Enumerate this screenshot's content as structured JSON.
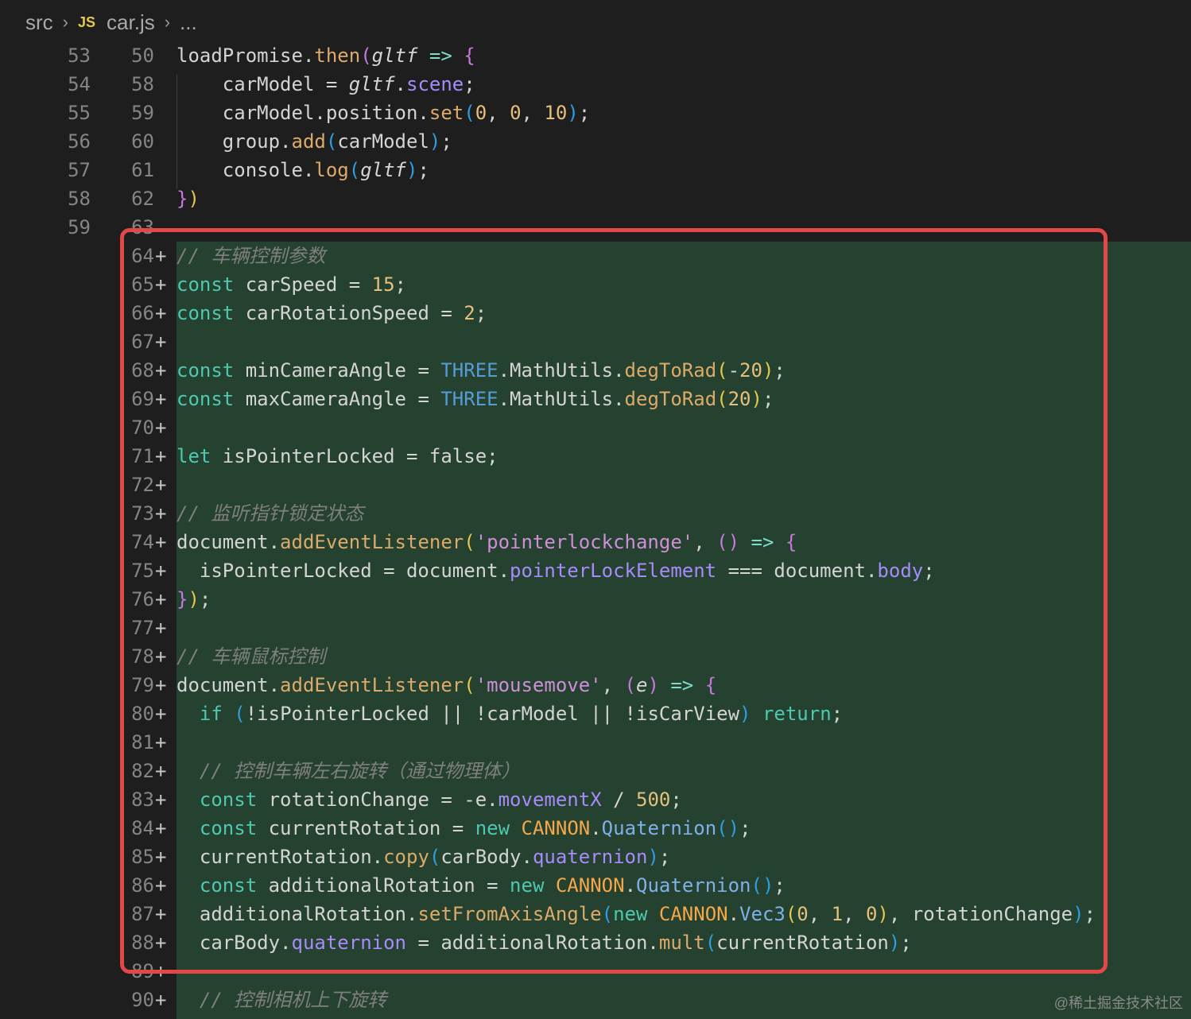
{
  "breadcrumb": {
    "folder": "src",
    "lang_badge": "JS",
    "file": "car.js",
    "ellipsis": "..."
  },
  "lines": [
    {
      "old": "53",
      "new": "50",
      "added": false,
      "tokens": [
        [
          "loadPromise.",
          ""
        ],
        [
          "then",
          "fn"
        ],
        [
          "(",
          "p2"
        ],
        [
          "gltf",
          "it"
        ],
        [
          " ",
          ""
        ],
        [
          "=>",
          "arrow"
        ],
        [
          " ",
          ""
        ],
        [
          "{",
          "p2"
        ]
      ]
    },
    {
      "old": "54",
      "new": "58",
      "added": false,
      "tokens": [
        [
          "    carModel = ",
          ""
        ],
        [
          "gltf",
          "it"
        ],
        [
          ".",
          ""
        ],
        [
          "scene",
          "prop"
        ],
        [
          ";",
          ""
        ]
      ]
    },
    {
      "old": "55",
      "new": "59",
      "added": false,
      "tokens": [
        [
          "    carModel.position.",
          ""
        ],
        [
          "set",
          "fn"
        ],
        [
          "(",
          "p3"
        ],
        [
          "0",
          "num"
        ],
        [
          ", ",
          ""
        ],
        [
          "0",
          "num"
        ],
        [
          ", ",
          ""
        ],
        [
          "10",
          "num"
        ],
        [
          ")",
          "p3"
        ],
        [
          ";",
          ""
        ]
      ]
    },
    {
      "old": "56",
      "new": "60",
      "added": false,
      "tokens": [
        [
          "    group.",
          ""
        ],
        [
          "add",
          "fn"
        ],
        [
          "(",
          "p3"
        ],
        [
          "carModel",
          ""
        ],
        [
          ")",
          "p3"
        ],
        [
          ";",
          ""
        ]
      ]
    },
    {
      "old": "57",
      "new": "61",
      "added": false,
      "tokens": [
        [
          "    console.",
          ""
        ],
        [
          "log",
          "fn"
        ],
        [
          "(",
          "p3"
        ],
        [
          "gltf",
          "it"
        ],
        [
          ")",
          "p3"
        ],
        [
          ";",
          ""
        ]
      ]
    },
    {
      "old": "58",
      "new": "62",
      "added": false,
      "tokens": [
        [
          "}",
          "p2"
        ],
        [
          ")",
          "p1"
        ]
      ]
    },
    {
      "old": "59",
      "new": "63",
      "added": false,
      "tokens": []
    },
    {
      "old": "",
      "new": "64",
      "added": true,
      "tokens": [
        [
          "// 车辆控制参数",
          "cmt"
        ]
      ]
    },
    {
      "old": "",
      "new": "65",
      "added": true,
      "tokens": [
        [
          "const",
          "kw"
        ],
        [
          " carSpeed = ",
          ""
        ],
        [
          "15",
          "num"
        ],
        [
          ";",
          ""
        ]
      ]
    },
    {
      "old": "",
      "new": "66",
      "added": true,
      "tokens": [
        [
          "const",
          "kw"
        ],
        [
          " carRotationSpeed = ",
          ""
        ],
        [
          "2",
          "num"
        ],
        [
          ";",
          ""
        ]
      ]
    },
    {
      "old": "",
      "new": "67",
      "added": true,
      "tokens": []
    },
    {
      "old": "",
      "new": "68",
      "added": true,
      "tokens": [
        [
          "const",
          "kw"
        ],
        [
          " minCameraAngle = ",
          ""
        ],
        [
          "THREE",
          "kw2"
        ],
        [
          ".MathUtils.",
          ""
        ],
        [
          "degToRad",
          "fn"
        ],
        [
          "(",
          "p1"
        ],
        [
          "-",
          ""
        ],
        [
          "20",
          "num"
        ],
        [
          ")",
          "p1"
        ],
        [
          ";",
          ""
        ]
      ]
    },
    {
      "old": "",
      "new": "69",
      "added": true,
      "tokens": [
        [
          "const",
          "kw"
        ],
        [
          " maxCameraAngle = ",
          ""
        ],
        [
          "THREE",
          "kw2"
        ],
        [
          ".MathUtils.",
          ""
        ],
        [
          "degToRad",
          "fn"
        ],
        [
          "(",
          "p1"
        ],
        [
          "20",
          "num"
        ],
        [
          ")",
          "p1"
        ],
        [
          ";",
          ""
        ]
      ]
    },
    {
      "old": "",
      "new": "70",
      "added": true,
      "tokens": []
    },
    {
      "old": "",
      "new": "71",
      "added": true,
      "tokens": [
        [
          "let",
          "kw"
        ],
        [
          " isPointerLocked = false;",
          ""
        ]
      ]
    },
    {
      "old": "",
      "new": "72",
      "added": true,
      "tokens": []
    },
    {
      "old": "",
      "new": "73",
      "added": true,
      "tokens": [
        [
          "// 监听指针锁定状态",
          "cmt"
        ]
      ]
    },
    {
      "old": "",
      "new": "74",
      "added": true,
      "tokens": [
        [
          "document.",
          ""
        ],
        [
          "addEventListener",
          "fn"
        ],
        [
          "(",
          "p1"
        ],
        [
          "'pointerlockchange'",
          "str"
        ],
        [
          ", ",
          ""
        ],
        [
          "()",
          "p2"
        ],
        [
          " ",
          ""
        ],
        [
          "=>",
          "arrow"
        ],
        [
          " ",
          ""
        ],
        [
          "{",
          "p2"
        ]
      ]
    },
    {
      "old": "",
      "new": "75",
      "added": true,
      "tokens": [
        [
          "  isPointerLocked = document.",
          ""
        ],
        [
          "pointerLockElement",
          "prop"
        ],
        [
          " === document.",
          ""
        ],
        [
          "body",
          "prop"
        ],
        [
          ";",
          ""
        ]
      ]
    },
    {
      "old": "",
      "new": "76",
      "added": true,
      "tokens": [
        [
          "}",
          "p2"
        ],
        [
          ")",
          "p1"
        ],
        [
          ";",
          ""
        ]
      ]
    },
    {
      "old": "",
      "new": "77",
      "added": true,
      "tokens": []
    },
    {
      "old": "",
      "new": "78",
      "added": true,
      "tokens": [
        [
          "// 车辆鼠标控制",
          "cmt"
        ]
      ]
    },
    {
      "old": "",
      "new": "79",
      "added": true,
      "tokens": [
        [
          "document.",
          ""
        ],
        [
          "addEventListener",
          "fn"
        ],
        [
          "(",
          "p1"
        ],
        [
          "'mousemove'",
          "str"
        ],
        [
          ", ",
          ""
        ],
        [
          "(",
          "p2"
        ],
        [
          "e",
          "it"
        ],
        [
          ")",
          "p2"
        ],
        [
          " ",
          ""
        ],
        [
          "=>",
          "arrow"
        ],
        [
          " ",
          ""
        ],
        [
          "{",
          "p2"
        ]
      ]
    },
    {
      "old": "",
      "new": "80",
      "added": true,
      "tokens": [
        [
          "  ",
          ""
        ],
        [
          "if",
          "kw"
        ],
        [
          " ",
          ""
        ],
        [
          "(",
          "p3"
        ],
        [
          "!isPointerLocked || !carModel || !isCarView",
          ""
        ],
        [
          ")",
          "p3"
        ],
        [
          " ",
          ""
        ],
        [
          "return",
          "kw"
        ],
        [
          ";",
          ""
        ]
      ]
    },
    {
      "old": "",
      "new": "81",
      "added": true,
      "tokens": []
    },
    {
      "old": "",
      "new": "82",
      "added": true,
      "tokens": [
        [
          "  ",
          ""
        ],
        [
          "// 控制车辆左右旋转（通过物理体）",
          "cmt"
        ]
      ]
    },
    {
      "old": "",
      "new": "83",
      "added": true,
      "tokens": [
        [
          "  ",
          ""
        ],
        [
          "const",
          "kw"
        ],
        [
          " rotationChange = -e.",
          ""
        ],
        [
          "movementX",
          "prop"
        ],
        [
          " / ",
          ""
        ],
        [
          "500",
          "num"
        ],
        [
          ";",
          ""
        ]
      ]
    },
    {
      "old": "",
      "new": "84",
      "added": true,
      "tokens": [
        [
          "  ",
          ""
        ],
        [
          "const",
          "kw"
        ],
        [
          " currentRotation = ",
          ""
        ],
        [
          "new",
          "kw"
        ],
        [
          " ",
          ""
        ],
        [
          "CANNON",
          "cls"
        ],
        [
          ".",
          ""
        ],
        [
          "Quaternion",
          "typ"
        ],
        [
          "()",
          "p3"
        ],
        [
          ";",
          ""
        ]
      ]
    },
    {
      "old": "",
      "new": "85",
      "added": true,
      "tokens": [
        [
          "  currentRotation.",
          ""
        ],
        [
          "copy",
          "fn"
        ],
        [
          "(",
          "p3"
        ],
        [
          "carBody.",
          ""
        ],
        [
          "quaternion",
          "prop"
        ],
        [
          ")",
          "p3"
        ],
        [
          ";",
          ""
        ]
      ]
    },
    {
      "old": "",
      "new": "86",
      "added": true,
      "tokens": [
        [
          "  ",
          ""
        ],
        [
          "const",
          "kw"
        ],
        [
          " additionalRotation = ",
          ""
        ],
        [
          "new",
          "kw"
        ],
        [
          " ",
          ""
        ],
        [
          "CANNON",
          "cls"
        ],
        [
          ".",
          ""
        ],
        [
          "Quaternion",
          "typ"
        ],
        [
          "()",
          "p3"
        ],
        [
          ";",
          ""
        ]
      ]
    },
    {
      "old": "",
      "new": "87",
      "added": true,
      "tokens": [
        [
          "  additionalRotation.",
          ""
        ],
        [
          "setFromAxisAngle",
          "fn"
        ],
        [
          "(",
          "p3"
        ],
        [
          "new",
          "kw"
        ],
        [
          " ",
          ""
        ],
        [
          "CANNON",
          "cls"
        ],
        [
          ".",
          ""
        ],
        [
          "Vec3",
          "typ"
        ],
        [
          "(",
          "p1"
        ],
        [
          "0",
          "num"
        ],
        [
          ", ",
          ""
        ],
        [
          "1",
          "num"
        ],
        [
          ", ",
          ""
        ],
        [
          "0",
          "num"
        ],
        [
          ")",
          "p1"
        ],
        [
          ", rotationChange",
          ""
        ],
        [
          ")",
          "p3"
        ],
        [
          ";",
          ""
        ]
      ]
    },
    {
      "old": "",
      "new": "88",
      "added": true,
      "tokens": [
        [
          "  carBody.",
          ""
        ],
        [
          "quaternion",
          "prop"
        ],
        [
          " = additionalRotation.",
          ""
        ],
        [
          "mult",
          "fn"
        ],
        [
          "(",
          "p3"
        ],
        [
          "currentRotation",
          ""
        ],
        [
          ")",
          "p3"
        ],
        [
          ";",
          ""
        ]
      ]
    },
    {
      "old": "",
      "new": "89",
      "added": true,
      "tokens": []
    },
    {
      "old": "",
      "new": "90",
      "added": true,
      "tokens": [
        [
          "  ",
          ""
        ],
        [
          "// 控制相机上下旋转",
          "cmt"
        ]
      ]
    }
  ],
  "watermark": "@稀土掘金技术社区"
}
